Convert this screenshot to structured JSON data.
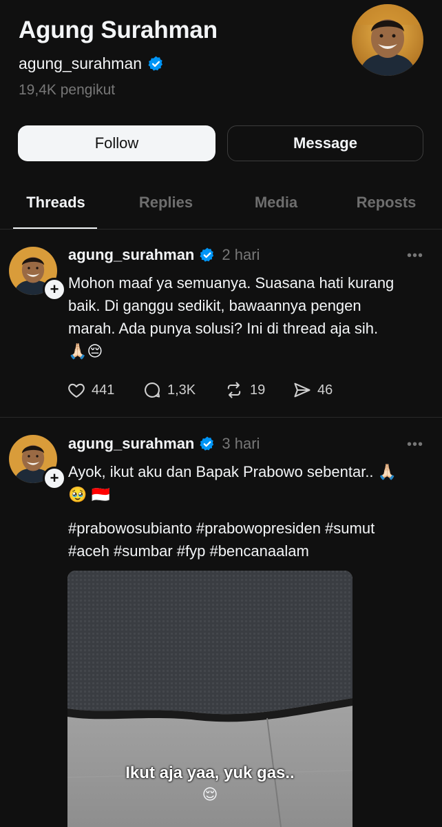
{
  "profile": {
    "name": "Agung Surahman",
    "handle": "agung_surahman",
    "followers": "19,4K pengikut",
    "follow_label": "Follow",
    "message_label": "Message"
  },
  "tabs": [
    {
      "label": "Threads",
      "active": true
    },
    {
      "label": "Replies",
      "active": false
    },
    {
      "label": "Media",
      "active": false
    },
    {
      "label": "Reposts",
      "active": false
    }
  ],
  "posts": [
    {
      "user": "agung_surahman",
      "time": "2 hari",
      "more": "•••",
      "lines": [
        "Mohon maaf ya semuanya. Suasana hati kurang",
        "baik. Di ganggu sedikit, bawaannya pengen",
        "marah. Ada punya solusi? Ini di thread aja sih.",
        "🙏🏻😔"
      ],
      "likes": "441",
      "comments": "1,3K",
      "reposts": "19",
      "shares": "46"
    },
    {
      "user": "agung_surahman",
      "time": "3 hari",
      "more": "•••",
      "lines": [
        "Ayok, ikut aku dan Bapak Prabowo sebentar.. 🙏🏻",
        "🥹 🇮🇩",
        "",
        "#prabowosubianto #prabowopresiden #sumut",
        "#aceh #sumbar #fyp #bencanaalam"
      ],
      "video_caption": "Ikut aja yaa, yuk gas..",
      "video_emoji": "😌"
    }
  ],
  "colors": {
    "background": "#101010",
    "text": "#f3f5f7",
    "muted": "#777777",
    "verified": "#0095f6"
  }
}
